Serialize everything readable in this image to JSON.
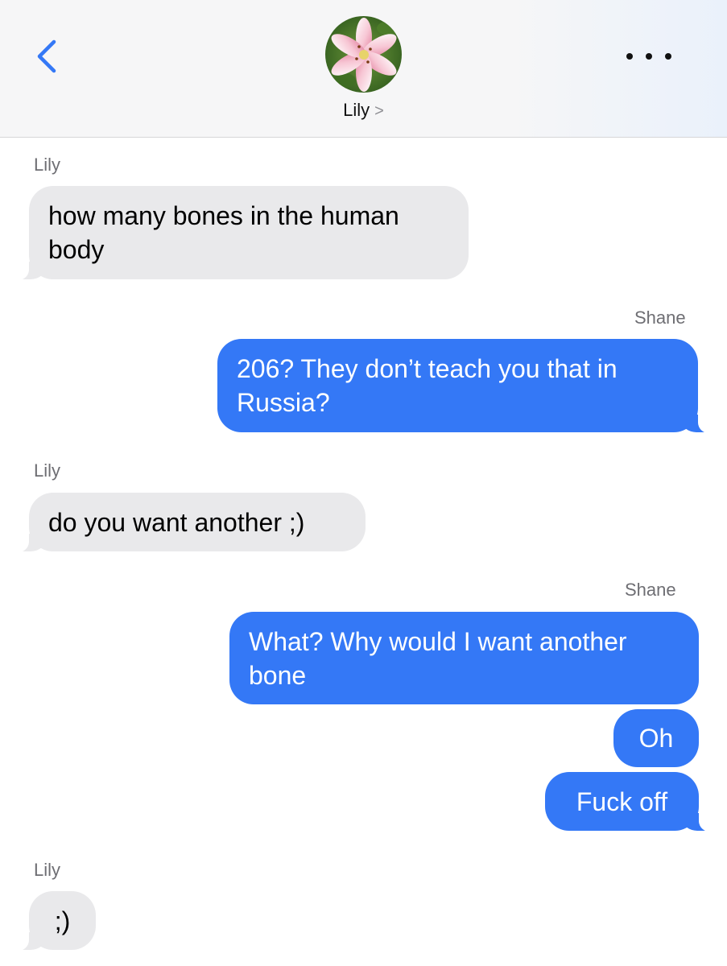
{
  "header": {
    "contact_name": "Lily",
    "contact_chevron": ">",
    "back_icon": "chevron-left-icon",
    "more_icon": "ellipsis-icon",
    "accent_color": "#3478f6"
  },
  "messages": [
    {
      "sender": "Lily",
      "direction": "incoming",
      "text": "how many bones in the human\nbody"
    },
    {
      "sender": "Shane",
      "direction": "outgoing",
      "text": "206? They don’t teach you that in\nRussia?"
    },
    {
      "sender": "Lily",
      "direction": "incoming",
      "text": "do you want another ;)"
    },
    {
      "sender": "Shane",
      "direction": "outgoing",
      "text": "What? Why would I want another\nbone"
    },
    {
      "sender": "",
      "direction": "outgoing",
      "text": "Oh"
    },
    {
      "sender": "",
      "direction": "outgoing",
      "text": "Fuck off"
    },
    {
      "sender": "Lily",
      "direction": "incoming",
      "text": ";)"
    }
  ],
  "colors": {
    "incoming_bubble": "#e9e9eb",
    "outgoing_bubble": "#3478f6",
    "sender_label": "#6e6e73"
  }
}
